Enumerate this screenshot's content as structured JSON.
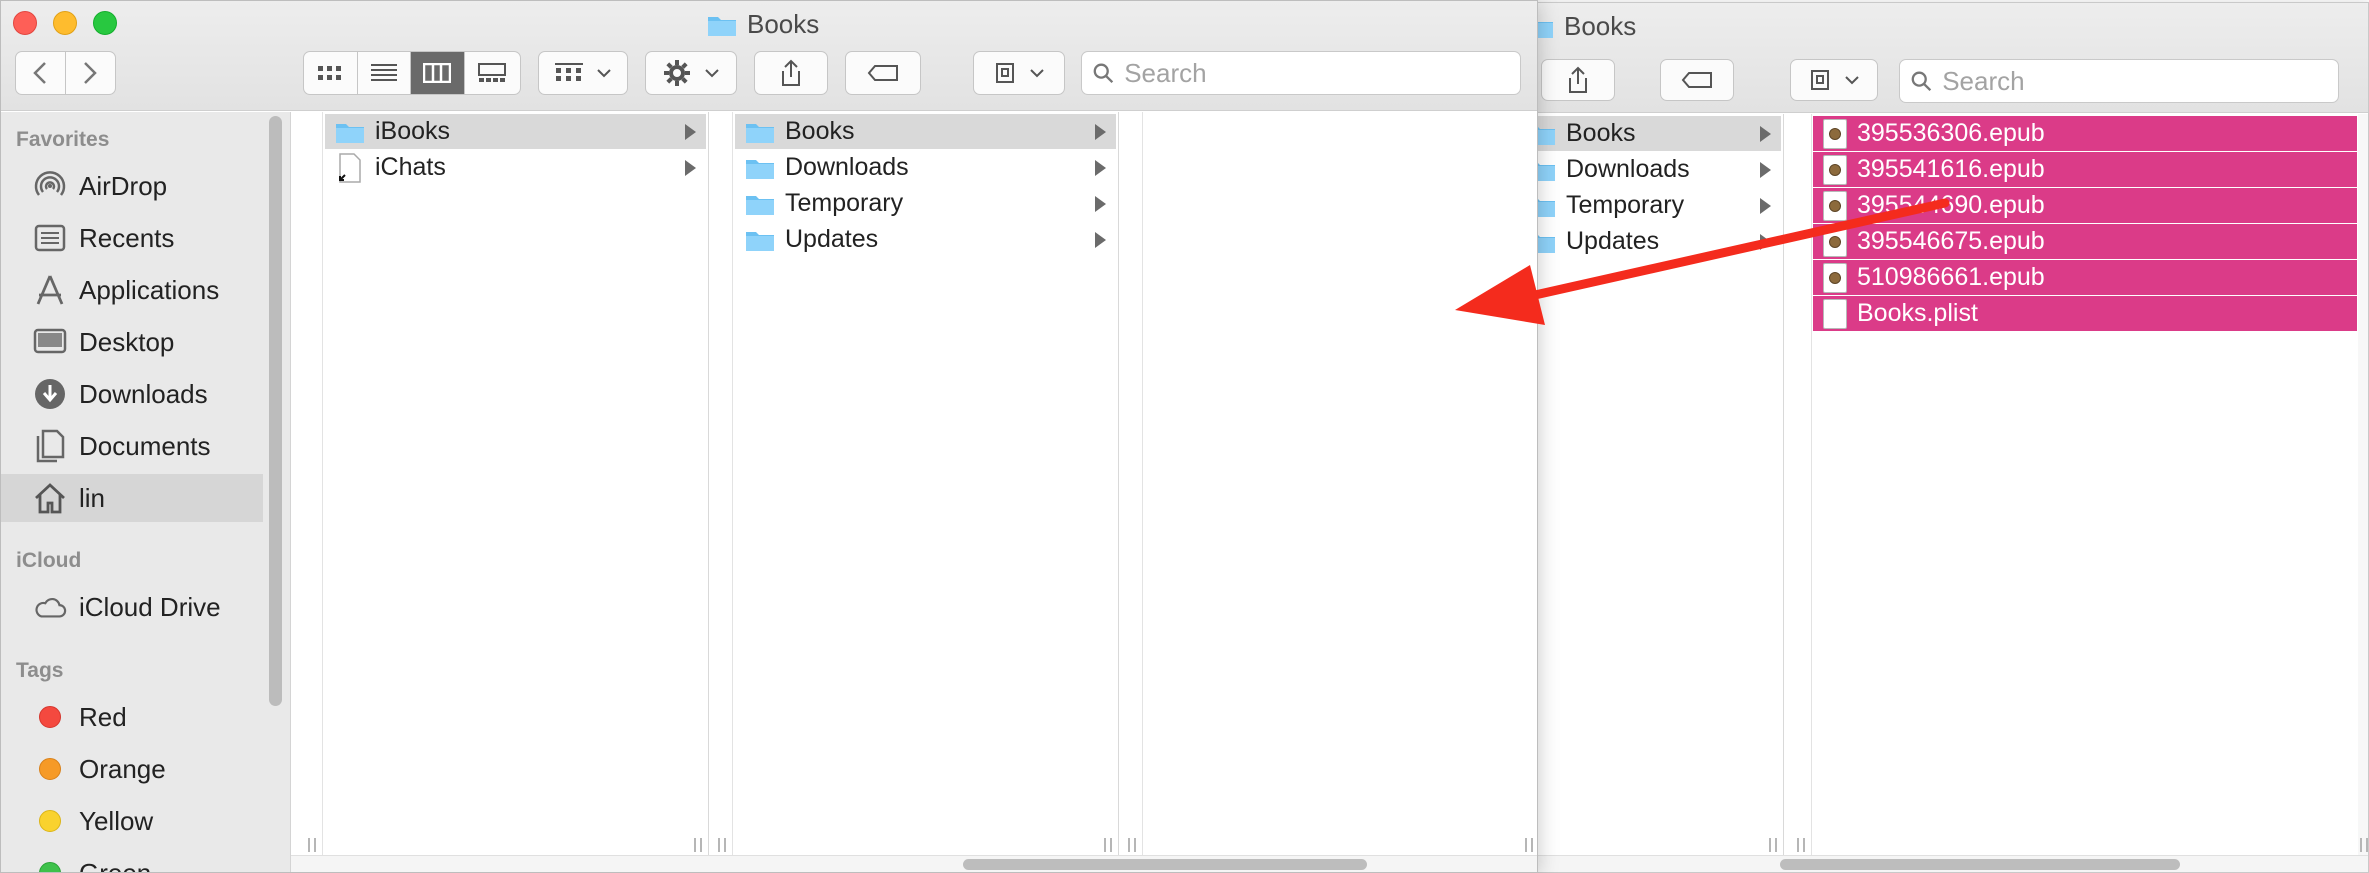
{
  "back_window": {
    "title": "Books",
    "search_placeholder": "Search",
    "folders": [
      {
        "label": "Books"
      },
      {
        "label": "Downloads"
      },
      {
        "label": "Temporary"
      },
      {
        "label": "Updates"
      }
    ],
    "files": [
      {
        "label": "395536306.epub",
        "icon": "epub-file-icon"
      },
      {
        "label": "395541616.epub",
        "icon": "epub-file-icon"
      },
      {
        "label": "395544690.epub",
        "icon": "epub-file-icon"
      },
      {
        "label": "395546675.epub",
        "icon": "epub-file-icon"
      },
      {
        "label": "510986661.epub",
        "icon": "epub-file-icon"
      },
      {
        "label": "Books.plist",
        "icon": "plist-file-icon"
      }
    ]
  },
  "front_window": {
    "title": "Books",
    "search_placeholder": "Search",
    "toolbar": {
      "view_modes": [
        "icon",
        "list",
        "column",
        "gallery"
      ],
      "active_view": "column"
    },
    "sidebar": {
      "favorites_header": "Favorites",
      "favorites": [
        {
          "label": "AirDrop",
          "icon": "airdrop-icon"
        },
        {
          "label": "Recents",
          "icon": "recents-icon"
        },
        {
          "label": "Applications",
          "icon": "applications-icon"
        },
        {
          "label": "Desktop",
          "icon": "desktop-icon"
        },
        {
          "label": "Downloads",
          "icon": "downloads-icon"
        },
        {
          "label": "Documents",
          "icon": "documents-icon"
        },
        {
          "label": "lin",
          "icon": "home-icon",
          "selected": true
        }
      ],
      "icloud_header": "iCloud",
      "icloud": [
        {
          "label": "iCloud Drive",
          "icon": "cloud-icon"
        }
      ],
      "tags_header": "Tags",
      "tags": [
        {
          "label": "Red",
          "color": "#f4493f"
        },
        {
          "label": "Orange",
          "color": "#f69a27"
        },
        {
          "label": "Yellow",
          "color": "#f9d22e"
        },
        {
          "label": "Green",
          "color": "#3ec14b"
        }
      ]
    },
    "column1": [
      {
        "label": "iBooks",
        "icon": "folder-icon",
        "selected": true
      },
      {
        "label": "iChats",
        "icon": "alias-file-icon"
      }
    ],
    "column2": [
      {
        "label": "Books",
        "selected": true
      },
      {
        "label": "Downloads"
      },
      {
        "label": "Temporary"
      },
      {
        "label": "Updates"
      }
    ]
  },
  "colors": {
    "folder_blue": "#6cc1f2",
    "selection_pink": "#db3b88",
    "annotation_red": "#f42b1d"
  }
}
